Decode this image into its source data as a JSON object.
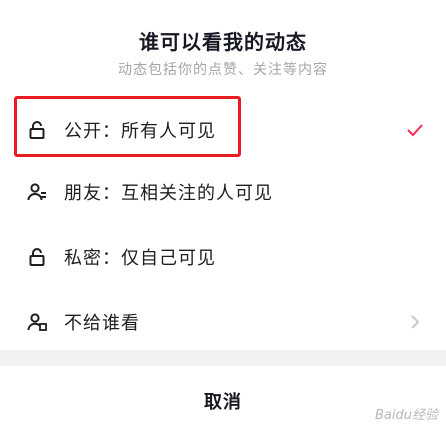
{
  "sheet": {
    "title": "谁可以看我的动态",
    "subtitle": "动态包括你的点赞、关注等内容"
  },
  "options": [
    {
      "icon": "lock-icon",
      "label": "公开：所有人可见",
      "selected": true
    },
    {
      "icon": "friends-icon",
      "label": "朋友：互相关注的人可见",
      "selected": false
    },
    {
      "icon": "lock-icon",
      "label": "私密：仅自己可见",
      "selected": false
    },
    {
      "icon": "user-block-icon",
      "label": "不给谁看",
      "has_arrow": true
    }
  ],
  "cancel_label": "取消",
  "watermark": "Baidu经验",
  "colors": {
    "highlight": "#e81b23",
    "check": "#fe2c55",
    "text": "#1f1f1f",
    "muted": "#a5a5aa"
  }
}
